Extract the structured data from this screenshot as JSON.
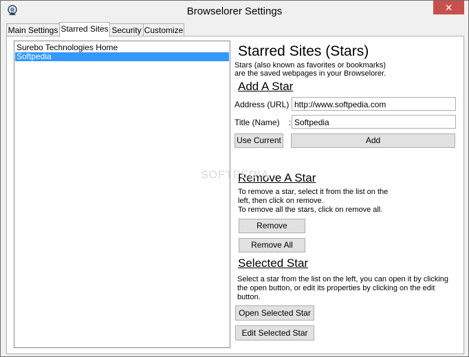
{
  "window": {
    "title": "Browselorer Settings",
    "close_glyph": "✕"
  },
  "tabs": [
    {
      "label": "Main Settings"
    },
    {
      "label": "Starred Sites"
    },
    {
      "label": "Security"
    },
    {
      "label": "Customize"
    }
  ],
  "stars_list": {
    "items": [
      "Surebo Technologies Home",
      "Softpedia"
    ],
    "selected_index": 1
  },
  "main": {
    "heading": "Starred Sites (Stars)",
    "desc_line1": "Stars (also known as favorites or bookmarks)",
    "desc_line2": "are the saved webpages in your Browselorer.",
    "add": {
      "heading": "Add A Star",
      "address_label": "Address (URL) :",
      "address_value": "http://www.softpedia.com",
      "title_label": "Title (Name)    :",
      "title_value": "Softpedia",
      "use_current_label": "Use Current",
      "add_label": "Add"
    },
    "remove": {
      "heading": "Remove A Star",
      "desc_line1": "To remove a star, select it from the list on the",
      "desc_line2": "left, then click on remove.",
      "desc_line3": "To remove all the stars, click on remove all.",
      "remove_label": "Remove",
      "remove_all_label": "Remove All"
    },
    "selected": {
      "heading": "Selected Star",
      "desc_line1": "Select a star from the list on the left, you can open it by clicking",
      "desc_line2": "the open button, or edit its properties by clicking on the edit",
      "desc_line3": "button.",
      "open_label": "Open Selected Star",
      "edit_label": "Edit Selected Star"
    }
  },
  "watermark": "SOFTPEDIA"
}
